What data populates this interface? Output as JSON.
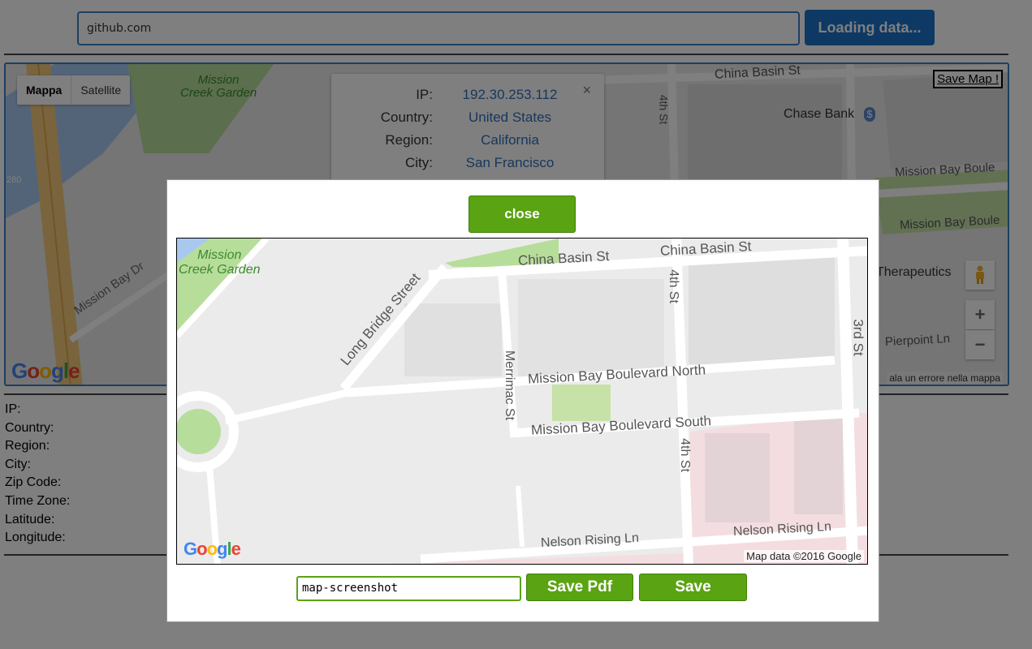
{
  "header": {
    "url_value": "github.com",
    "loading_label": "Loading data..."
  },
  "bg_map": {
    "toggle": {
      "map": "Mappa",
      "satellite": "Satellite"
    },
    "save_map": "Save Map !",
    "labels": {
      "mission_creek_1": "Mission",
      "mission_creek_2": "Creek Garden",
      "china_basin": "China Basin St",
      "chase_bank": "Chase Bank",
      "fourth_st": "4th St",
      "mission_bay_blvd_1": "Mission Bay Boule",
      "mission_bay_blvd_2": "Mission Bay Boule",
      "therapeutics": "Therapeutics",
      "pierpoint": "Pierpoint Ln",
      "mission_bay_dr": "Mission Bay Dr",
      "highway": "280",
      "dollar": "$"
    },
    "report": "ala un errore nella mappa",
    "zoom_in": "+",
    "zoom_out": "−",
    "popup": {
      "close": "×",
      "rows": [
        {
          "key": "IP:",
          "value": "192.30.253.112"
        },
        {
          "key": "Country:",
          "value": "United States"
        },
        {
          "key": "Region:",
          "value": "California"
        },
        {
          "key": "City:",
          "value": "San Francisco"
        }
      ]
    }
  },
  "details": [
    "IP:",
    "Country:",
    "Region:",
    "City:",
    "Zip Code:",
    "Time Zone:",
    "Latitude:",
    "Longitude:"
  ],
  "google": {
    "g": "G",
    "o1": "o",
    "o2": "o",
    "g2": "g",
    "l": "l",
    "e": "e"
  },
  "modal": {
    "close_label": "close",
    "filename_value": "map-screenshot",
    "save_pdf_label": "Save Pdf",
    "save_label": "Save",
    "attribution": "Map data ©2016 Google",
    "labels": {
      "mission_creek_1": "Mission",
      "mission_creek_2": "Creek Garden",
      "china_basin_1": "China Basin St",
      "china_basin_2": "China Basin St",
      "long_bridge": "Long Bridge Street",
      "fourth_st_1": "4th St",
      "fourth_st_2": "4th St",
      "third_st": "3rd St",
      "merrimac": "Merrimac St",
      "mb_north": "Mission Bay Boulevard North",
      "mb_south": "Mission Bay Boulevard South",
      "nelson_1": "Nelson Rising Ln",
      "nelson_2": "Nelson Rising Ln"
    }
  },
  "colors": {
    "accent_green": "#5aa313",
    "loading_blue": "#1a73c9",
    "link_blue": "#2f6fb9"
  }
}
